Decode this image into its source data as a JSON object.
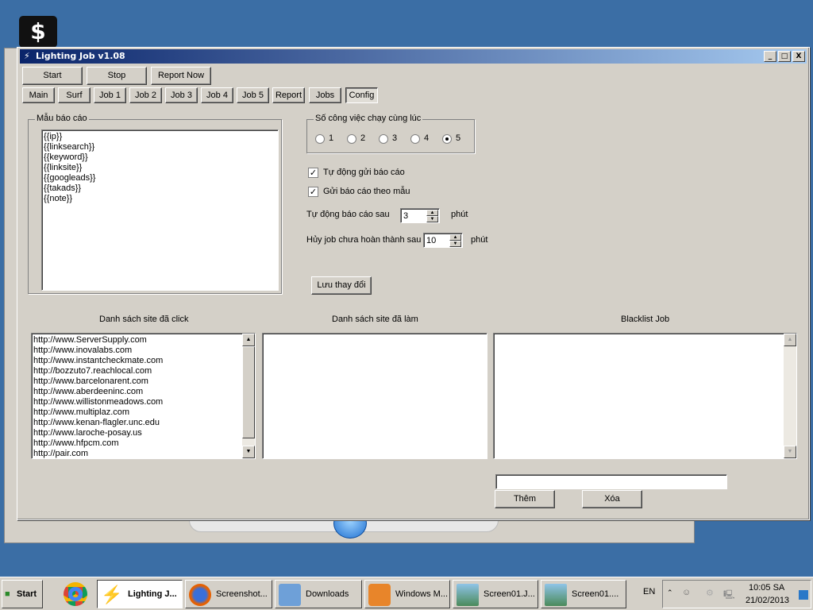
{
  "desktop": {
    "icon_glyph": "$"
  },
  "window": {
    "title": "Lighting Job v1.08",
    "controls": [
      "_",
      "□",
      "X"
    ]
  },
  "toolbar": {
    "start": "Start",
    "stop": "Stop",
    "report_now": "Report Now"
  },
  "tabs": [
    "Main",
    "Surf",
    "Job 1",
    "Job 2",
    "Job 3",
    "Job 4",
    "Job 5",
    "Report",
    "Jobs",
    "Config"
  ],
  "active_tab": "Config",
  "template_group": {
    "label": "Mẫu báo cáo",
    "lines": [
      "{{ip}}",
      "{{linksearch}}",
      "{{keyword}}",
      "{{linksite}}",
      "{{googleads}}",
      "{{takads}}",
      "{{note}}"
    ]
  },
  "concurrency": {
    "label": "Số công việc chạy cùng lúc",
    "options": [
      "1",
      "2",
      "3",
      "4",
      "5"
    ],
    "selected": "5"
  },
  "auto_send": {
    "label": "Tự động gửi báo cáo",
    "checked": true
  },
  "send_template": {
    "label": "Gửi báo cáo theo mẫu",
    "checked": true
  },
  "auto_report": {
    "label": "Tự động báo cáo sau",
    "value": "3",
    "unit": "phút"
  },
  "cancel_job": {
    "label": "Hủy job chưa hoàn thành sau",
    "value": "10",
    "unit": "phút"
  },
  "save_button": "Lưu thay đổi",
  "clicked_sites": {
    "header": "Danh sách site đã click",
    "items": [
      "http://www.ServerSupply.com",
      "http://www.inovalabs.com",
      "http://www.instantcheckmate.com",
      "http://bozzuto7.reachlocal.com",
      "http://www.barcelonarent.com",
      "http://www.aberdeeninc.com",
      "http://www.willistonmeadows.com",
      "http://www.multiplaz.com",
      "http://www.kenan-flagler.unc.edu",
      "http://www.laroche-posay.us",
      "http://www.hfpcm.com",
      "http://pair.com"
    ]
  },
  "done_sites": {
    "header": "Danh sách site đã làm",
    "items": []
  },
  "blacklist": {
    "header": "Blacklist Job",
    "items": [],
    "input_value": "",
    "add": "Thêm",
    "delete": "Xóa"
  },
  "taskbar": {
    "start": "Start",
    "items": [
      "Lighting J...",
      "Screenshot...",
      "Downloads",
      "Windows M...",
      "Screen01.J...",
      "Screen01...."
    ],
    "lang": "EN",
    "time": "10:05 SA",
    "date": "21/02/2013"
  }
}
